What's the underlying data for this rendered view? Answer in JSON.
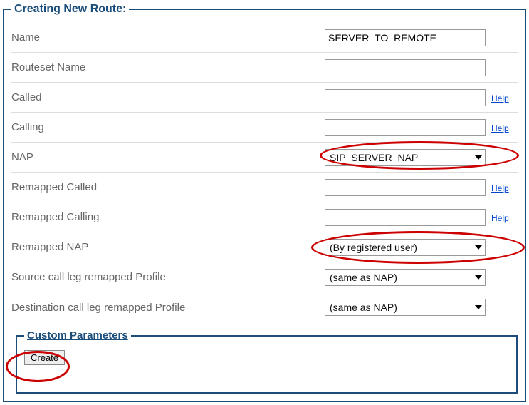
{
  "fieldset_title": "Creating New Route:",
  "help_text": "Help",
  "fields": {
    "name": {
      "label": "Name",
      "value": "SERVER_TO_REMOTE"
    },
    "routeset_name": {
      "label": "Routeset Name",
      "value": ""
    },
    "called": {
      "label": "Called",
      "value": ""
    },
    "calling": {
      "label": "Calling",
      "value": ""
    },
    "nap": {
      "label": "NAP",
      "selected": "SIP_SERVER_NAP"
    },
    "remapped_called": {
      "label": "Remapped Called",
      "value": ""
    },
    "remapped_calling": {
      "label": "Remapped Calling",
      "value": ""
    },
    "remapped_nap": {
      "label": "Remapped NAP",
      "selected": "(By registered user)"
    },
    "src_profile": {
      "label": "Source call leg remapped Profile",
      "selected": "(same as NAP)"
    },
    "dst_profile": {
      "label": "Destination call leg remapped Profile",
      "selected": "(same as NAP)"
    }
  },
  "custom_params_title": "Custom Parameters",
  "create_label": "Create"
}
